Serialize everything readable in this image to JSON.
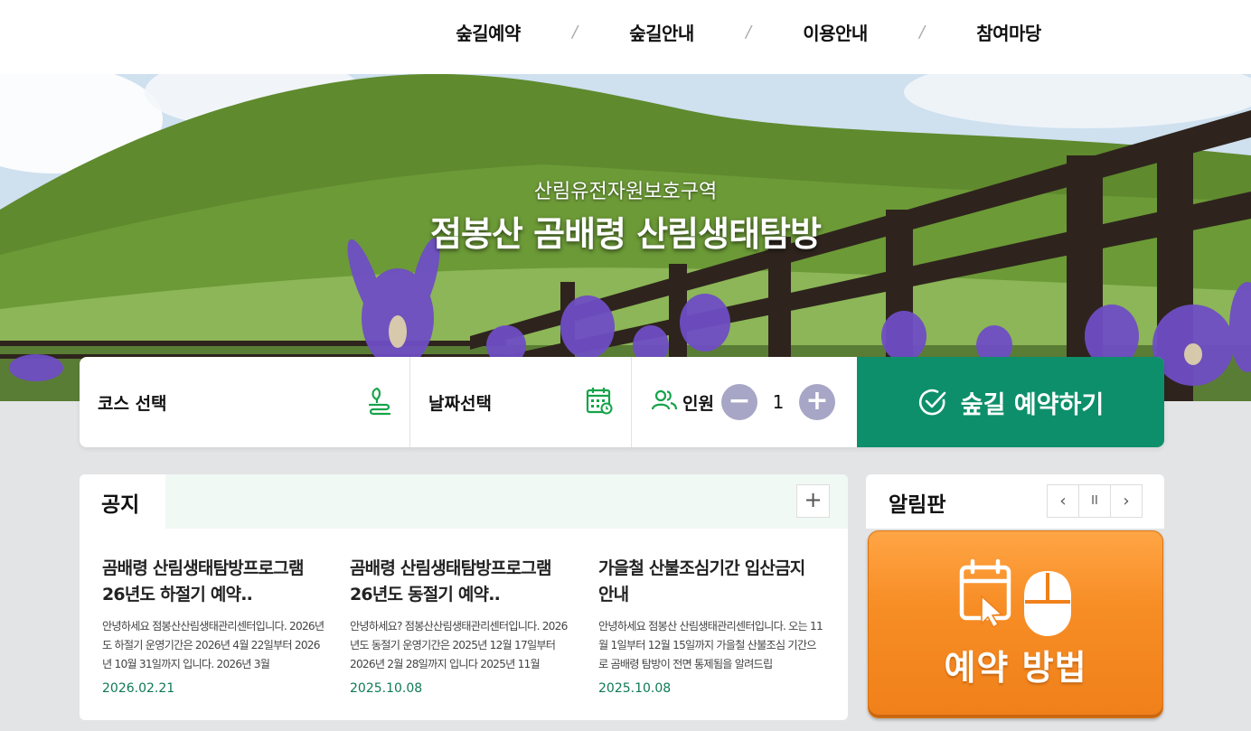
{
  "nav": {
    "items": [
      "숲길예약",
      "숲길안내",
      "이용안내",
      "참여마당"
    ],
    "separator": "/"
  },
  "hero": {
    "subtitle": "산림유전자원보호구역",
    "title": "점봉산 곰배령 산림생태탐방"
  },
  "booking": {
    "course_label": "코스 선택",
    "date_label": "날짜선택",
    "people_label": "인원",
    "people_count": "1",
    "minus": "−",
    "plus": "+",
    "submit_label": "숲길 예약하기"
  },
  "notice": {
    "title": "공지",
    "more": "+",
    "posts": [
      {
        "title": "곰배령 산림생태탐방프로그램 26년도 하절기 예약..",
        "body": "안녕하세요 점봉산산림생태관리센터입니다. 2026년도 하절기 운영기간은 2026년 4월 22일부터 2026년 10월 31일까지 입니다. 2026년 3월",
        "date": "2026.02.21"
      },
      {
        "title": "곰배령 산림생태탐방프로그램 26년도 동절기 예약..",
        "body": "안녕하세요? 점봉산산림생태관리센터입니다. 2026년도 동절기 운영기간은 2025년 12월 17일부터 2026년 2월 28일까지 입니다 2025년 11월",
        "date": "2025.10.08"
      },
      {
        "title": "가을철 산불조심기간 입산금지 안내",
        "body": "안녕하세요 점봉산 산림생태관리센터입니다. 오는 11월 1일부터 12월 15일까지 가을철 산불조심 기간으로 곰배령 탐방이 전면 통제됨을 알려드립",
        "date": "2025.10.08"
      }
    ]
  },
  "board": {
    "title": "알림판",
    "prev": "‹",
    "pause": "II",
    "next": "›",
    "banner_text": "예약 방법",
    "banner_color": "#f78d25"
  },
  "colors": {
    "accent": "#0e8f6b",
    "stepper": "#a7a6c6"
  }
}
